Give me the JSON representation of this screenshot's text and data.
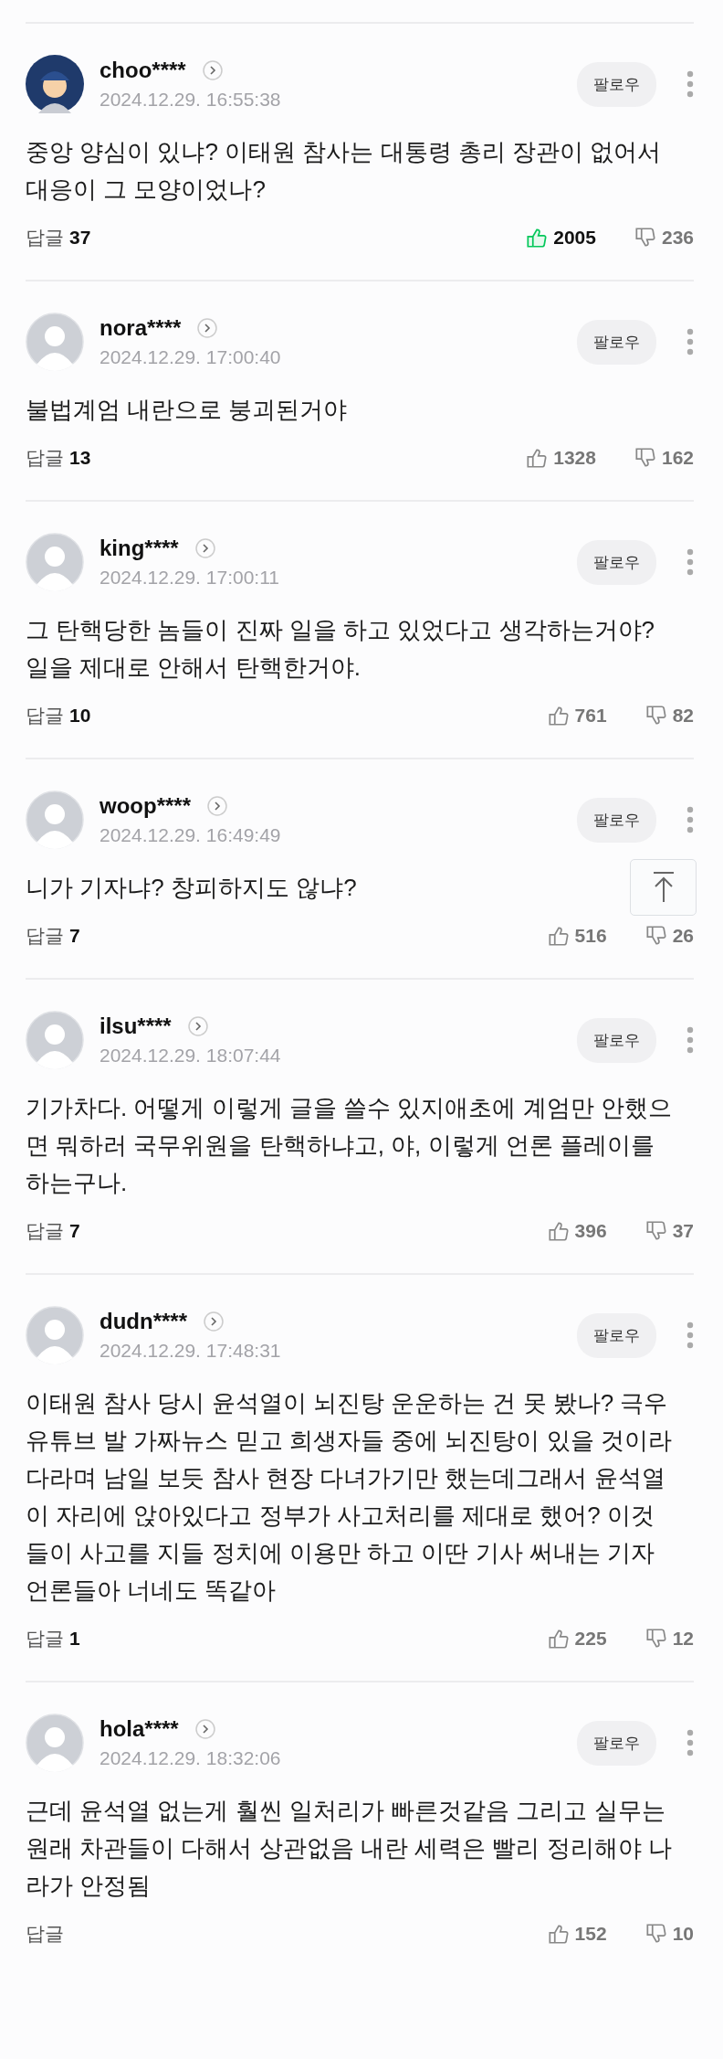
{
  "comments": [
    {
      "user": "choo****",
      "avatar": {
        "kind": "custom"
      },
      "date": "2024.12.29. 16:55:38",
      "follow": "팔로우",
      "text": "중앙 양심이 있냐? 이태원 참사는 대통령 총리 장관이 없어서 대응이 그 모양이었나?",
      "reply_label": "답글",
      "reply_count": "37",
      "likes": "2005",
      "liked": true,
      "dislikes": "236"
    },
    {
      "user": "nora****",
      "avatar": {
        "kind": "default"
      },
      "date": "2024.12.29. 17:00:40",
      "follow": "팔로우",
      "text": "불법계엄 내란으로 붕괴된거야",
      "reply_label": "답글",
      "reply_count": "13",
      "likes": "1328",
      "liked": false,
      "dislikes": "162"
    },
    {
      "user": "king****",
      "avatar": {
        "kind": "default"
      },
      "date": "2024.12.29. 17:00:11",
      "follow": "팔로우",
      "text": "그 탄핵당한 놈들이 진짜 일을 하고 있었다고 생각하는거야? 일을 제대로 안해서 탄핵한거야.",
      "reply_label": "답글",
      "reply_count": "10",
      "likes": "761",
      "liked": false,
      "dislikes": "82"
    },
    {
      "user": "woop****",
      "avatar": {
        "kind": "default"
      },
      "date": "2024.12.29. 16:49:49",
      "follow": "팔로우",
      "text": "니가 기자냐? 창피하지도 않냐?",
      "reply_label": "답글",
      "reply_count": "7",
      "likes": "516",
      "liked": false,
      "dislikes": "26"
    },
    {
      "user": "ilsu****",
      "avatar": {
        "kind": "default"
      },
      "date": "2024.12.29. 18:07:44",
      "follow": "팔로우",
      "text": "기가차다. 어떻게 이렇게 글을 쓸수 있지애초에 계엄만 안했으면 뭐하러 국무위원을 탄핵하냐고, 야, 이렇게 언론 플레이를 하는구나.",
      "reply_label": "답글",
      "reply_count": "7",
      "likes": "396",
      "liked": false,
      "dislikes": "37"
    },
    {
      "user": "dudn****",
      "avatar": {
        "kind": "default"
      },
      "date": "2024.12.29. 17:48:31",
      "follow": "팔로우",
      "text": "이태원 참사 당시 윤석열이 뇌진탕 운운하는 건 못 봤나? 극우 유튜브 발 가짜뉴스 믿고 희생자들 중에 뇌진탕이 있을 것이라다라며 남일 보듯 참사 현장 다녀가기만 했는데그래서 윤석열이 자리에 앉아있다고 정부가 사고처리를 제대로 했어? 이것들이 사고를 지들 정치에 이용만 하고 이딴 기사 써내는 기자 언론들아 너네도 똑같아",
      "reply_label": "답글",
      "reply_count": "1",
      "likes": "225",
      "liked": false,
      "dislikes": "12"
    },
    {
      "user": "hola****",
      "avatar": {
        "kind": "default"
      },
      "date": "2024.12.29. 18:32:06",
      "follow": "팔로우",
      "text": "근데 윤석열 없는게 훨씬 일처리가 빠른것같음 그리고 실무는 원래 차관들이 다해서 상관없음 내란 세력은 빨리 정리해야 나라가 안정됨",
      "reply_label": "답글",
      "likes": "152",
      "liked": false,
      "dislikes": "10"
    }
  ]
}
